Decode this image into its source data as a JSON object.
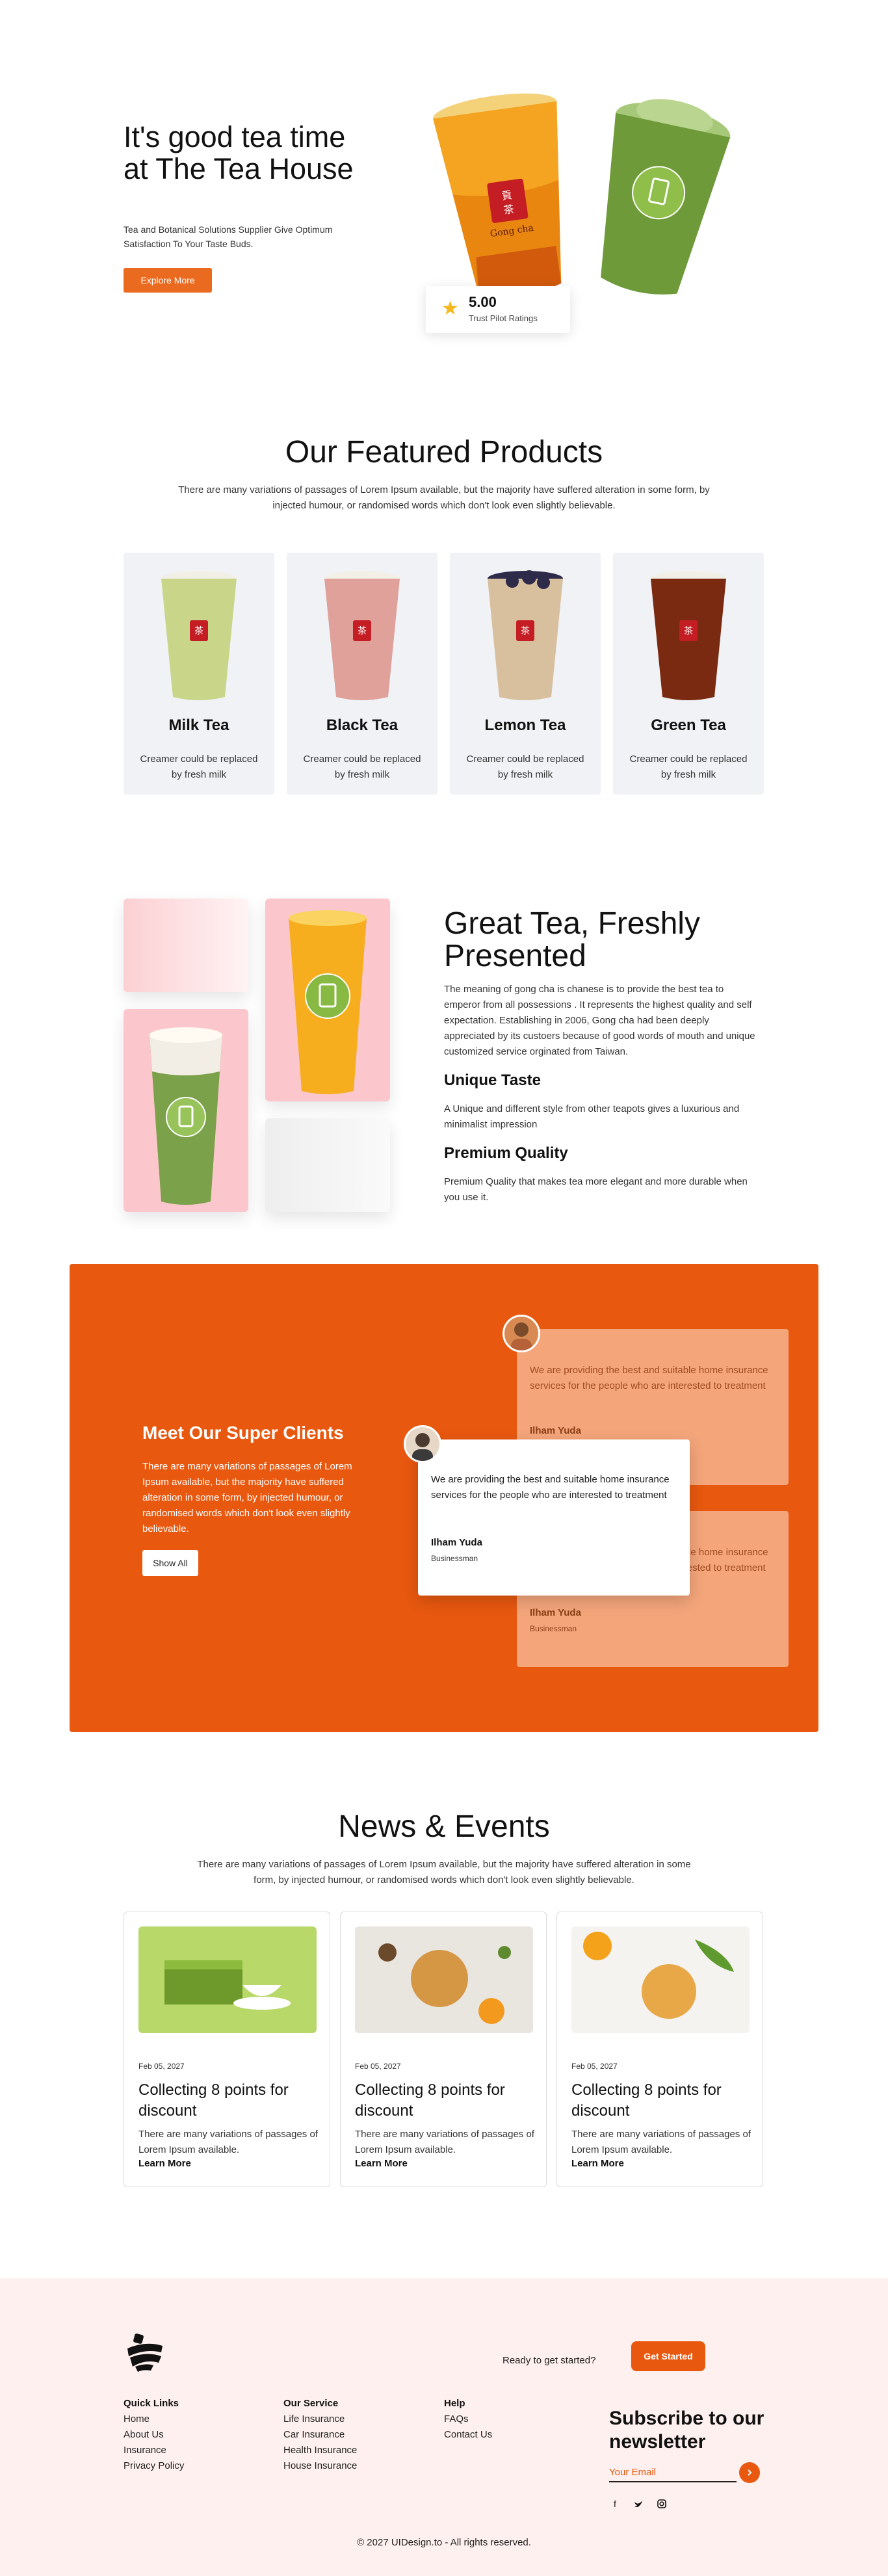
{
  "hero": {
    "title": "It's good tea time at The Tea House",
    "subtitle": "Tea and Botanical Solutions Supplier Give Optimum Satisfaction To Your Taste Buds.",
    "cta_label": "Explore More",
    "cup_brand": "Gong cha",
    "rating": {
      "score": "5.00",
      "label": "Trust Pilot Ratings",
      "icon": "star-icon"
    }
  },
  "products": {
    "title": "Our Featured Products",
    "description": "There are many variations of passages of Lorem Ipsum available, but the majority have suffered alteration in some form, by injected humour, or randomised words which don't look even slightly believable.",
    "items": [
      {
        "name": "Milk Tea",
        "desc": "Creamer could be replaced by fresh milk",
        "tea_color": "#c9d68a"
      },
      {
        "name": "Black Tea",
        "desc": "Creamer could be replaced by fresh milk",
        "tea_color": "#dfa19a"
      },
      {
        "name": "Lemon Tea",
        "desc": "Creamer could be replaced by fresh milk",
        "tea_color": "#d8c09f"
      },
      {
        "name": "Green Tea",
        "desc": "Creamer could be replaced by fresh milk",
        "tea_color": "#7a2a10"
      }
    ]
  },
  "great_tea": {
    "title": "Great Tea, Freshly Presented",
    "body": "The meaning of gong cha is chanese is to provide the best tea to emperor from all possessions . It represents the highest quality and self expectation. Establishing in 2006, Gong cha had been deeply appreciated by its custoers because of good words of mouth and unique customized service orginated from Taiwan.",
    "features": [
      {
        "title": "Unique Taste",
        "body": "A Unique and different style from other teapots gives a luxurious and minimalist impression"
      },
      {
        "title": "Premium Quality",
        "body": "Premium Quality that makes tea more elegant and more durable when you use it."
      }
    ]
  },
  "clients": {
    "title": "Meet Our Super Clients",
    "body": "There are many variations of passages of Lorem Ipsum available, but the majority have suffered alteration in some form, by injected humour, or randomised words which don't look even slightly believable.",
    "button_label": "Show All",
    "testimonials": [
      {
        "text": "We are providing the best and suitable home insurance services for the people who are interested to treatment",
        "name": "Ilham Yuda",
        "role": "Businessman"
      },
      {
        "text": "We are providing the best and suitable home insurance services for the people who are interested to treatment",
        "name": "Ilham Yuda",
        "role": "Businessman"
      },
      {
        "text": "We are providing the best and suitable home insurance services for the people who are interested to treatment",
        "name": "Ilham Yuda",
        "role": "Businessman"
      }
    ]
  },
  "news": {
    "title": "News & Events",
    "description": "There are many variations of passages of Lorem Ipsum available, but the majority have suffered alteration in some form, by injected humour, or randomised words which don't look even slightly believable.",
    "items": [
      {
        "date": "Feb 05, 2027",
        "headline": "Collecting 8 points for discount",
        "excerpt": "There are many variations of passages of Lorem Ipsum available.",
        "link": "Learn More"
      },
      {
        "date": "Feb 05, 2027",
        "headline": "Collecting 8 points for discount",
        "excerpt": "There are many variations of passages of Lorem Ipsum available.",
        "link": "Learn More"
      },
      {
        "date": "Feb 05, 2027",
        "headline": "Collecting 8 points for discount",
        "excerpt": "There are many variations of passages of Lorem Ipsum available.",
        "link": "Learn More"
      }
    ]
  },
  "footer": {
    "logo_icon": "brand-logo-icon",
    "ready_text": "Ready to get started?",
    "cta_label": "Get Started",
    "columns": [
      {
        "title": "Quick Links",
        "links": [
          "Home",
          "About Us",
          "Insurance",
          "Privacy Policy"
        ]
      },
      {
        "title": "Our Service",
        "links": [
          "Life Insurance",
          "Car Insurance",
          "Health Insurance",
          "House Insurance"
        ]
      },
      {
        "title": "Help",
        "links": [
          "FAQs",
          "Contact Us"
        ]
      }
    ],
    "newsletter": {
      "title": "Subscribe to our newsletter",
      "placeholder": "Your Email"
    },
    "social": [
      "facebook-icon",
      "twitter-icon",
      "instagram-icon"
    ],
    "copyright": "© 2027 UIDesign.to - All rights reserved."
  },
  "colors": {
    "accent": "#e8580f",
    "button": "#ea6a20",
    "card_bg": "#f0f2f6",
    "footer_bg": "#fdf0ef"
  }
}
